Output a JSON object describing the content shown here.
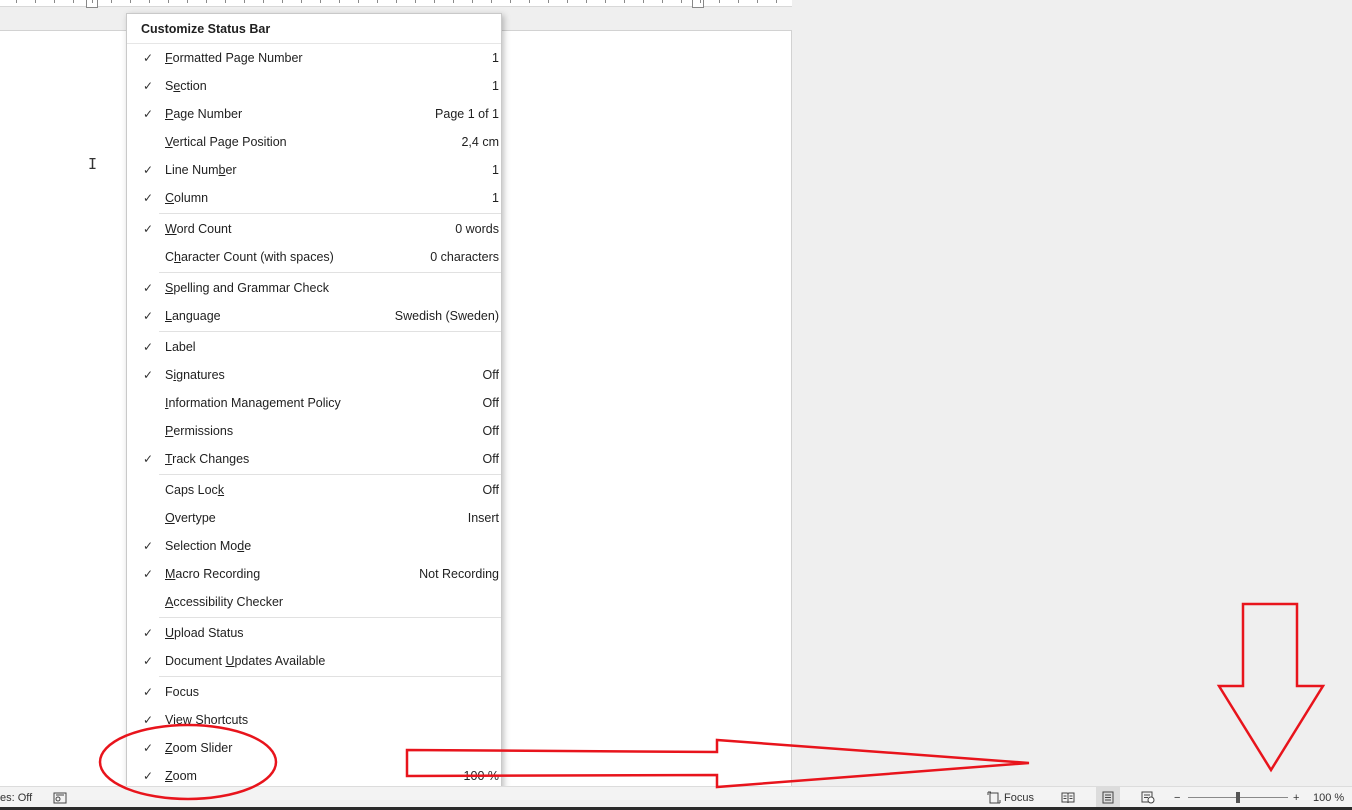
{
  "menu": {
    "title": "Customize Status Bar",
    "groups": [
      [
        {
          "pre": "",
          "ul": "F",
          "post": "ormatted Page Number",
          "value": "1",
          "checked": true
        },
        {
          "pre": "S",
          "ul": "e",
          "post": "ction",
          "value": "1",
          "checked": true
        },
        {
          "pre": "",
          "ul": "P",
          "post": "age Number",
          "value": "Page 1 of 1",
          "checked": true
        },
        {
          "pre": "",
          "ul": "V",
          "post": "ertical Page Position",
          "value": "2,4 cm",
          "checked": false
        },
        {
          "pre": "Line Num",
          "ul": "b",
          "post": "er",
          "value": "1",
          "checked": true
        },
        {
          "pre": "",
          "ul": "C",
          "post": "olumn",
          "value": "1",
          "checked": true
        }
      ],
      [
        {
          "pre": "",
          "ul": "W",
          "post": "ord Count",
          "value": "0 words",
          "checked": true
        },
        {
          "pre": "C",
          "ul": "h",
          "post": "aracter Count (with spaces)",
          "value": "0 characters",
          "checked": false
        }
      ],
      [
        {
          "pre": "",
          "ul": "S",
          "post": "pelling and Grammar Check",
          "value": "",
          "checked": true
        },
        {
          "pre": "",
          "ul": "L",
          "post": "anguage",
          "value": "Swedish (Sweden)",
          "checked": true
        }
      ],
      [
        {
          "pre": "",
          "ul": "",
          "post": "Label",
          "value": "",
          "checked": true
        },
        {
          "pre": "S",
          "ul": "i",
          "post": "gnatures",
          "value": "Off",
          "checked": true
        },
        {
          "pre": "",
          "ul": "I",
          "post": "nformation Management Policy",
          "value": "Off",
          "checked": false
        },
        {
          "pre": "",
          "ul": "P",
          "post": "ermissions",
          "value": "Off",
          "checked": false
        },
        {
          "pre": "",
          "ul": "T",
          "post": "rack Changes",
          "value": "Off",
          "checked": true
        }
      ],
      [
        {
          "pre": "Caps Loc",
          "ul": "k",
          "post": "",
          "value": "Off",
          "checked": false
        },
        {
          "pre": "",
          "ul": "O",
          "post": "vertype",
          "value": "Insert",
          "checked": false
        },
        {
          "pre": "Selection Mo",
          "ul": "d",
          "post": "e",
          "value": "",
          "checked": true
        },
        {
          "pre": "",
          "ul": "M",
          "post": "acro Recording",
          "value": "Not Recording",
          "checked": true
        },
        {
          "pre": "",
          "ul": "A",
          "post": "ccessibility Checker",
          "value": "",
          "checked": false
        }
      ],
      [
        {
          "pre": "",
          "ul": "U",
          "post": "pload Status",
          "value": "",
          "checked": true
        },
        {
          "pre": "Document ",
          "ul": "U",
          "post": "pdates Available",
          "value": "",
          "checked": true
        }
      ],
      [
        {
          "pre": "",
          "ul": "",
          "post": "Focus",
          "value": "",
          "checked": true
        },
        {
          "pre": "",
          "ul": "V",
          "post": "iew Shortcuts",
          "value": "",
          "checked": true
        },
        {
          "pre": "",
          "ul": "Z",
          "post": "oom Slider",
          "value": "",
          "checked": true
        },
        {
          "pre": "",
          "ul": "Z",
          "post": "oom",
          "value": "100 %",
          "checked": true
        }
      ]
    ],
    "check_glyph": "✓"
  },
  "statusbar": {
    "left_text": "es: Off",
    "focus_label": "Focus",
    "zoom_minus": "−",
    "zoom_plus": "+",
    "zoom_value": "100 %"
  },
  "document": {
    "cursor_glyph": "I"
  },
  "annotation": {
    "color": "#e8141c"
  }
}
